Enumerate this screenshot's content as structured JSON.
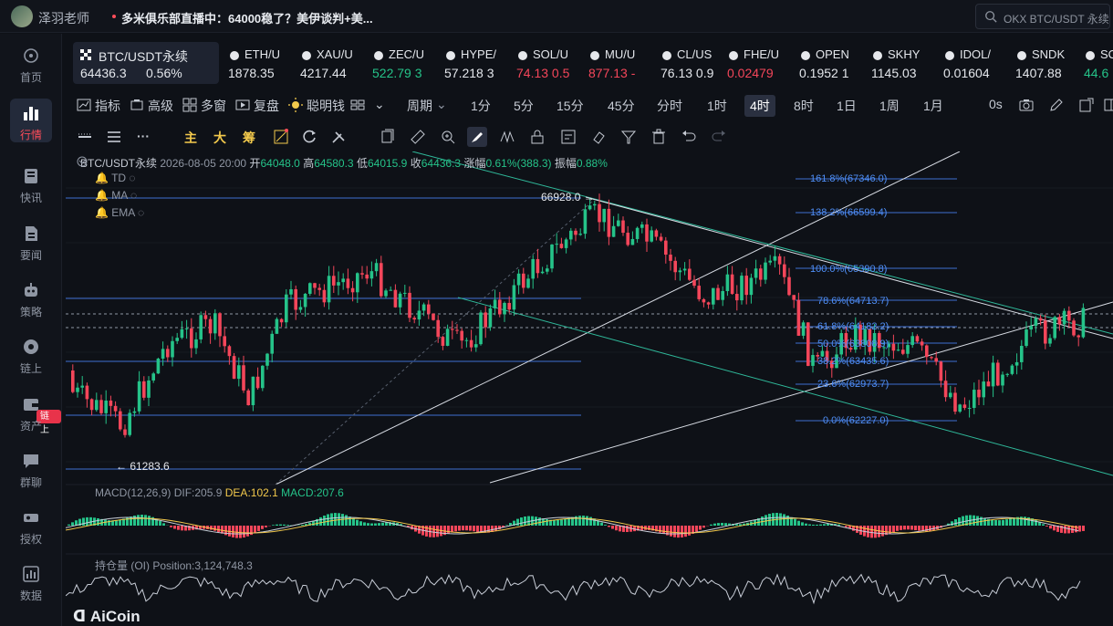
{
  "topbar": {
    "user_name": "泽羽老师",
    "live_text": "多米俱乐部直播中：64000稳了？美伊谈判+美...",
    "search_text": "OKX BTC/USDT 永续"
  },
  "sidebar": {
    "items": [
      {
        "label": "首页",
        "icon": "home-icon"
      },
      {
        "label": "行情",
        "icon": "market-icon"
      },
      {
        "label": "快讯",
        "icon": "news-icon"
      },
      {
        "label": "要闻",
        "icon": "article-icon"
      },
      {
        "label": "策略",
        "icon": "robot-icon"
      },
      {
        "label": "链上",
        "icon": "chain-icon"
      },
      {
        "label": "资产",
        "icon": "wallet-icon"
      },
      {
        "label": "群聊",
        "icon": "chat-icon"
      },
      {
        "label": "授权",
        "icon": "key-icon"
      },
      {
        "label": "数据",
        "icon": "data-icon"
      }
    ],
    "chain_badge": "链上"
  },
  "tickers": [
    {
      "symbol": "BTC/USDT永续",
      "price": "64436.3",
      "change": "0.56%",
      "trend": "neutral"
    },
    {
      "symbol": "ETH/U",
      "price": "1878.35",
      "trend": "neutral"
    },
    {
      "symbol": "XAU/U",
      "price": "4217.44",
      "trend": "neutral"
    },
    {
      "symbol": "ZEC/U",
      "price": "522.79 3",
      "trend": "up"
    },
    {
      "symbol": "HYPE/",
      "price": "57.218 3",
      "trend": "neutral"
    },
    {
      "symbol": "SOL/U",
      "price": "74.13 0.5",
      "trend": "down"
    },
    {
      "symbol": "MU/U",
      "price": "877.13 -",
      "trend": "down"
    },
    {
      "symbol": "CL/US",
      "price": "76.13 0.9",
      "trend": "neutral"
    },
    {
      "symbol": "FHE/U",
      "price": "0.02479",
      "trend": "down"
    },
    {
      "symbol": "OPEN",
      "price": "0.1952 1",
      "trend": "neutral"
    },
    {
      "symbol": "SKHY",
      "price": "1145.03",
      "trend": "neutral"
    },
    {
      "symbol": "IDOL/",
      "price": "0.01604",
      "trend": "neutral"
    },
    {
      "symbol": "SNDK",
      "price": "1407.88",
      "trend": "neutral"
    },
    {
      "symbol": "SO",
      "price": "44.6",
      "trend": "up"
    }
  ],
  "toolbar": {
    "indicator": "指标",
    "advanced": "高级",
    "multi_window": "多窗",
    "replay": "复盘",
    "smart_money": "聪明钱",
    "period": "周期",
    "intervals": [
      "1分",
      "5分",
      "15分",
      "45分",
      "分时",
      "1时",
      "4时",
      "8时",
      "1日",
      "1周",
      "1月"
    ],
    "active_interval": "4时",
    "countdown": "0s"
  },
  "draw_tools": {
    "main": "主",
    "big": "大",
    "chip": "筹"
  },
  "legend": {
    "symbol": "BTC/USDT永续",
    "datetime": "2026-08-05 20:00",
    "open_label": "开",
    "open": "64048.0",
    "high_label": "高",
    "high": "64580.3",
    "low_label": "低",
    "low": "64015.9",
    "close_label": "收",
    "close": "64436.3",
    "change_label": "涨幅",
    "change": "0.61%(388.3)",
    "amp_label": "振幅",
    "amp": "0.88%",
    "indicators": [
      "TD",
      "MA",
      "EMA"
    ]
  },
  "annotations": {
    "high_mark": "66928.0 →",
    "low_mark": "← 61283.6"
  },
  "fib_levels": [
    "161.8%(67346.0)",
    "138.2%(66599.4)",
    "100.0%(65390.8)",
    "78.6%(64713.7)",
    "61.8%(64182.2)",
    "50.0%(63808.9)",
    "38.2%(63435.6)",
    "23.6%(62973.7)",
    "0.0%(62227.0)"
  ],
  "macd": {
    "name": "MACD(12,26,9)",
    "dif": "DIF:205.9",
    "dea": "DEA:102.1",
    "macd": "MACD:207.6",
    "colors": {
      "dif": "#c9ced8",
      "dea": "#f2c94c",
      "macd": "#e05566"
    }
  },
  "oi": {
    "name": "持仓量 (OI)",
    "value": "Position:3,124,748.3"
  },
  "logo": "AiCoin",
  "colors": {
    "up": "#25c389",
    "down": "#f4465a",
    "accent": "#4f8ff7",
    "background": "#0e1117"
  }
}
